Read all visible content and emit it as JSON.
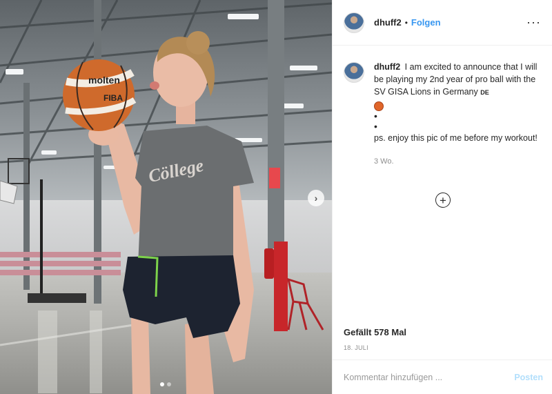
{
  "post": {
    "image_alt": "",
    "carousel": {
      "count": 2,
      "active_index": 0
    }
  },
  "header": {
    "username": "dhuff2",
    "separator": "•",
    "follow_label": "Folgen",
    "more_icon": "more-options-icon",
    "more_glyph": "···"
  },
  "caption": {
    "username": "dhuff2",
    "text": "I am excited to announce that I will be playing my 2nd year of pro ball with the SV GISA Lions in Germany",
    "flag_text": "DE",
    "bullet_1": "•",
    "bullet_2": "•",
    "ps_text": "ps. enjoy this pic of me before my workout!",
    "time": "3 Wo."
  },
  "load_more": {
    "glyph": "+"
  },
  "likes": {
    "text": "Gefällt 578 Mal"
  },
  "date": {
    "text": "18. JULI"
  },
  "comment": {
    "placeholder": "Kommentar hinzufügen ...",
    "post_label": "Posten"
  },
  "colors": {
    "link_blue": "#3897f0",
    "post_disabled": "#b2dffc",
    "secondary_text": "#8e8e8e",
    "border": "#efefef"
  }
}
